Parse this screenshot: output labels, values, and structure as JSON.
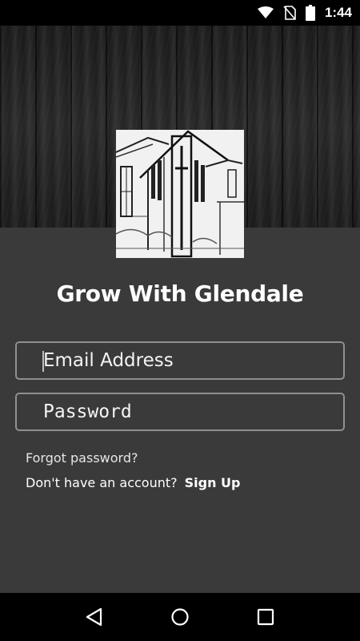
{
  "status_bar": {
    "time": "1:44",
    "icons": [
      "wifi-icon",
      "no-sim-icon",
      "battery-icon"
    ]
  },
  "app": {
    "title": "Grow With Glendale",
    "logo": "church-sketch-logo"
  },
  "form": {
    "email_placeholder": "Email Address",
    "email_value": "",
    "password_placeholder": "Password",
    "password_value": ""
  },
  "links": {
    "forgot_password": "Forgot password?",
    "no_account": "Don't have an account?",
    "sign_up": "Sign Up"
  },
  "nav_bar": {
    "buttons": [
      "back-icon",
      "home-icon",
      "recents-icon"
    ]
  },
  "colors": {
    "background": "#3a3a3a",
    "field_border": "#8f8f8f",
    "text": "#ffffff"
  }
}
